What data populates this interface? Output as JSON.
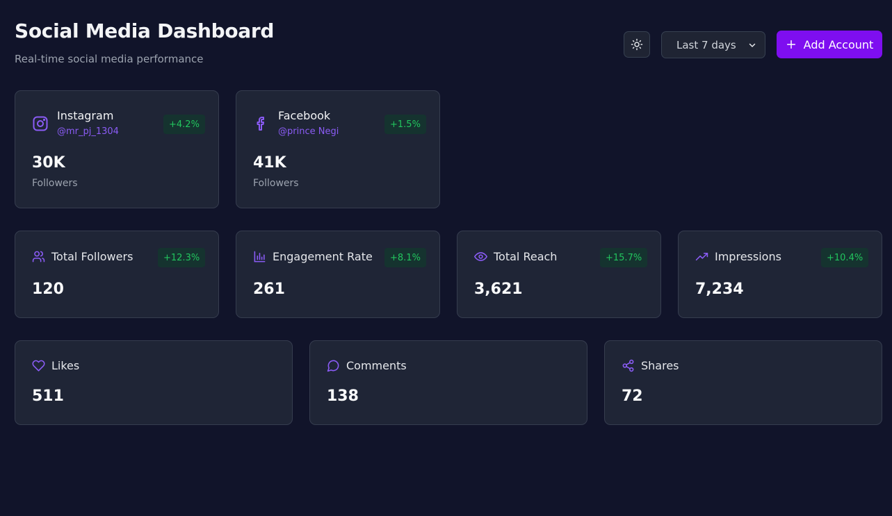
{
  "header": {
    "title": "Social Media Dashboard",
    "subtitle": "Real-time social media performance",
    "theme_toggle_icon": "sun-icon",
    "range_select": "Last 7 days",
    "add_account_label": "Add Account"
  },
  "accounts": [
    {
      "name": "Instagram",
      "handle": "@mr_pj_1304",
      "change": "+4.2%",
      "value": "30K",
      "label": "Followers",
      "icon": "instagram-icon"
    },
    {
      "name": "Facebook",
      "handle": "@prince Negi",
      "change": "+1.5%",
      "value": "41K",
      "label": "Followers",
      "icon": "facebook-icon"
    }
  ],
  "stats": [
    {
      "name": "Total Followers",
      "change": "+12.3%",
      "value": "120",
      "icon": "users-icon"
    },
    {
      "name": "Engagement Rate",
      "change": "+8.1%",
      "value": "261",
      "icon": "bar-chart-icon"
    },
    {
      "name": "Total Reach",
      "change": "+15.7%",
      "value": "3,621",
      "icon": "eye-icon"
    },
    {
      "name": "Impressions",
      "change": "+10.4%",
      "value": "7,234",
      "icon": "trending-up-icon"
    }
  ],
  "engagement": [
    {
      "name": "Likes",
      "value": "511",
      "icon": "heart-icon"
    },
    {
      "name": "Comments",
      "value": "138",
      "icon": "message-circle-icon"
    },
    {
      "name": "Shares",
      "value": "72",
      "icon": "share-icon"
    }
  ],
  "colors": {
    "accent": "#8b5cf6",
    "button": "#7e0ef0",
    "positive": "#22c55e",
    "background": "#11142a",
    "card": "#1f2536"
  }
}
